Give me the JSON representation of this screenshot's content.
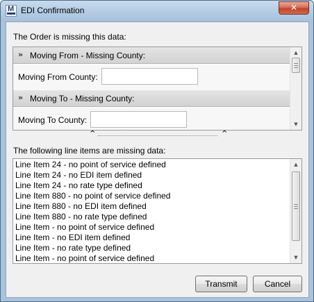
{
  "window": {
    "title": "EDI Confirmation",
    "close_glyph": "✕",
    "app_icon": "app-logo-icon"
  },
  "order_section": {
    "heading": "The Order is missing this data:",
    "groups": [
      {
        "header": "Moving From - Missing County:",
        "field_label": "Moving From County:",
        "field_value": ""
      },
      {
        "header": "Moving To - Missing County:",
        "field_label": "Moving To County:",
        "field_value": ""
      }
    ]
  },
  "line_items_section": {
    "heading": "The following line items are missing data:",
    "items": [
      "Line Item 24 - no point of service defined",
      "Line Item 24 - no EDI item defined",
      "Line Item 24 - no rate type defined",
      "Line Item 880 - no point of service defined",
      "Line Item 880 - no EDI item defined",
      "Line Item 880 - no rate type defined",
      "Line Item  - no point of service defined",
      "Line Item  - no EDI item defined",
      "Line Item  - no rate type defined",
      "Line Item  - no point of service defined"
    ]
  },
  "buttons": {
    "transmit": "Transmit",
    "cancel": "Cancel"
  },
  "icons": {
    "collapse": "double-chevron-down-icon",
    "scroll_up": "arrow-up-icon",
    "scroll_down": "arrow-down-icon",
    "splitter": "splitter-handle-icon"
  },
  "colors": {
    "title_bar": "#b4cde5",
    "close_button": "#c2432b",
    "section_header": "#d2d2d2"
  }
}
